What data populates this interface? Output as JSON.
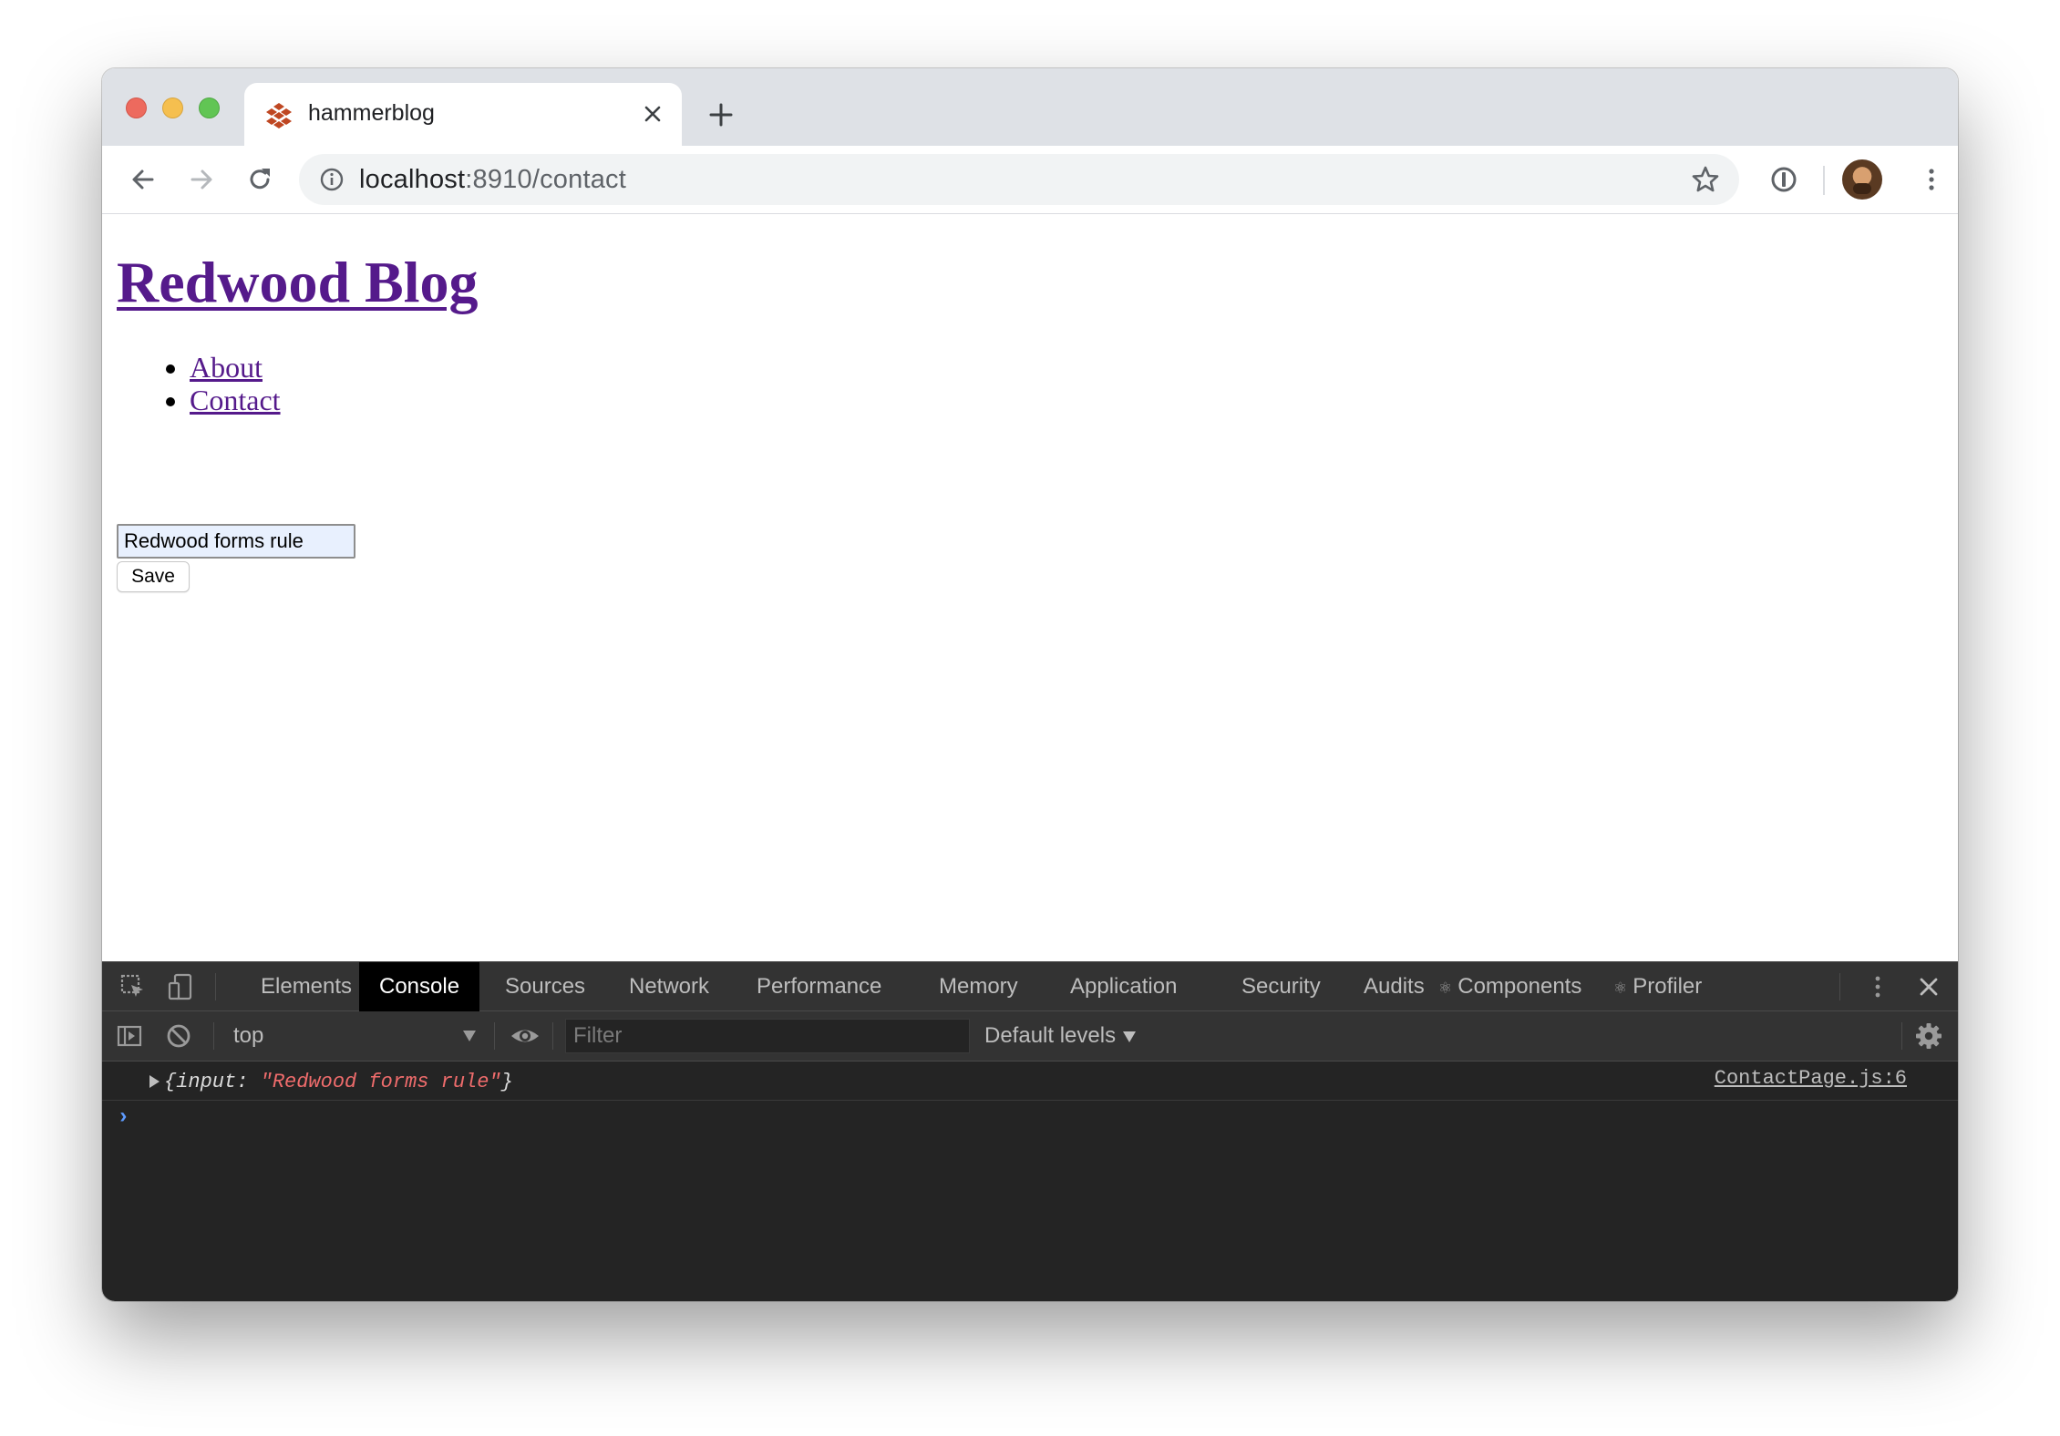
{
  "browser": {
    "tab_title": "hammerblog",
    "url_host": "localhost",
    "url_rest": ":8910/contact"
  },
  "page": {
    "site_title": "Redwood Blog",
    "nav_items": [
      "About",
      "Contact"
    ],
    "input_value": "Redwood forms rule",
    "save_label": "Save"
  },
  "devtools": {
    "tabs": [
      "Elements",
      "Console",
      "Sources",
      "Network",
      "Performance",
      "Memory",
      "Application",
      "Security",
      "Audits",
      "Components",
      "Profiler"
    ],
    "active_tab": "Console",
    "context": "top",
    "filter_placeholder": "Filter",
    "levels": "Default levels",
    "log": {
      "prefix": "{input: ",
      "string": "\"Redwood forms rule\"",
      "suffix": "}",
      "source": "ContactPage.js:6"
    },
    "prompt": "›"
  },
  "colors": {
    "link_visited": "#551a8b",
    "devtools_bg": "#242424",
    "console_string": "#ef6c6c"
  }
}
